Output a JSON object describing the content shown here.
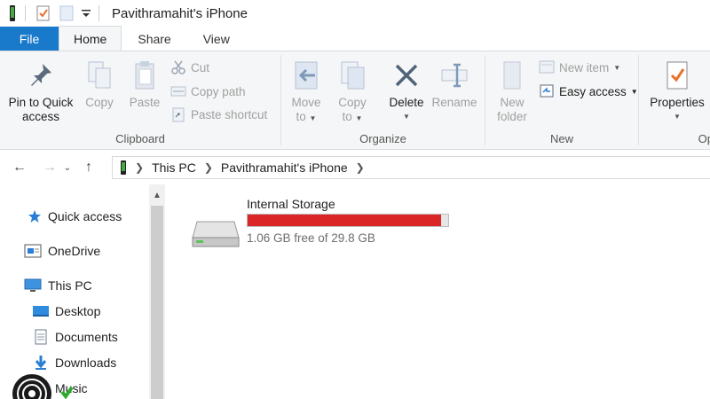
{
  "window": {
    "title": "Pavithramahit's iPhone"
  },
  "quick_access_toolbar": {
    "icons": [
      "phone-icon",
      "properties-check-icon",
      "new-folder-icon",
      "customize-dropdown-icon"
    ]
  },
  "tabs": [
    {
      "label": "File"
    },
    {
      "label": "Home"
    },
    {
      "label": "Share"
    },
    {
      "label": "View"
    }
  ],
  "ribbon": {
    "clipboard": {
      "label": "Clipboard",
      "pin_label_line1": "Pin to Quick",
      "pin_label_line2": "access",
      "copy_label": "Copy",
      "paste_label": "Paste",
      "cut_label": "Cut",
      "copy_path_label": "Copy path",
      "paste_shortcut_label": "Paste shortcut"
    },
    "organize": {
      "label": "Organize",
      "move_to_line1": "Move",
      "move_to_line2": "to",
      "copy_to_line1": "Copy",
      "copy_to_line2": "to",
      "delete_label": "Delete",
      "rename_label": "Rename"
    },
    "new": {
      "label": "New",
      "new_folder_line1": "New",
      "new_folder_line2": "folder",
      "new_item_label": "New item",
      "easy_access_label": "Easy access"
    },
    "open": {
      "label": "Op",
      "properties_label": "Properties"
    }
  },
  "address_bar": {
    "crumbs": [
      "This PC",
      "Pavithramahit's iPhone"
    ]
  },
  "nav_pane": {
    "items": [
      {
        "label": "Quick access",
        "icon": "star-icon"
      },
      {
        "label": "OneDrive",
        "icon": "onedrive-icon"
      },
      {
        "label": "This PC",
        "icon": "computer-icon"
      },
      {
        "label": "Desktop",
        "icon": "desktop-folder-icon"
      },
      {
        "label": "Documents",
        "icon": "documents-icon"
      },
      {
        "label": "Downloads",
        "icon": "downloads-icon"
      },
      {
        "label": "Music",
        "icon": "music-icon"
      }
    ]
  },
  "drive": {
    "name": "Internal Storage",
    "free_text": "1.06 GB free of 29.8 GB",
    "used_fraction": 0.964,
    "bar_color": "#da2626"
  },
  "colors": {
    "file_tab": "#1979ca",
    "ribbon_bg": "#f5f6f7",
    "accent_blue": "#2a7fd4"
  }
}
